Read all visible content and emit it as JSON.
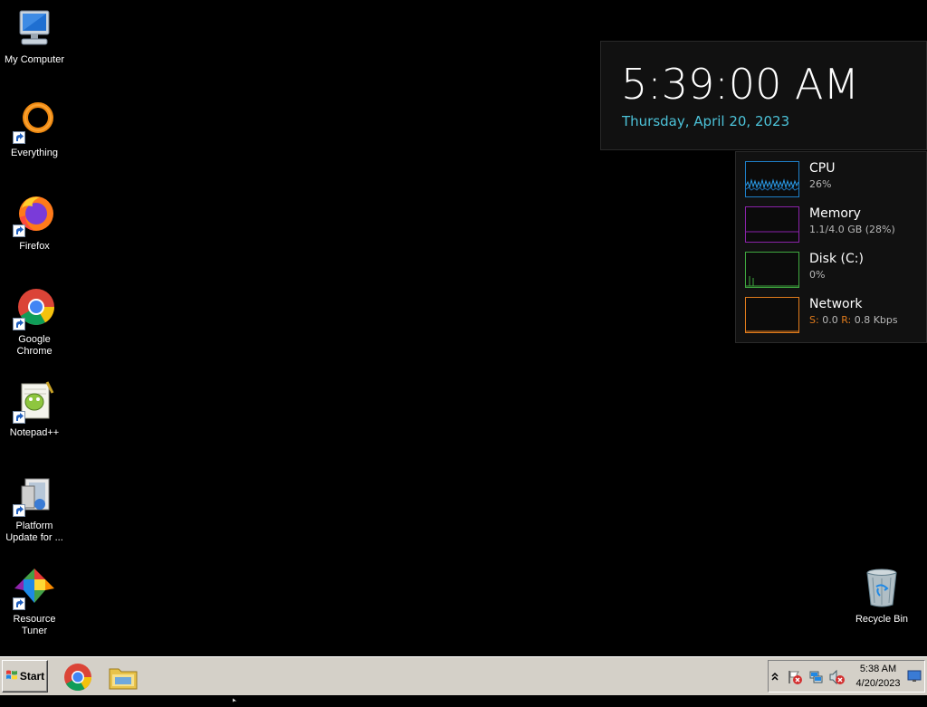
{
  "desktop": {
    "icons": [
      {
        "id": "my-computer",
        "label": "My Computer",
        "icon": "computer-icon"
      },
      {
        "id": "everything",
        "label": "Everything",
        "icon": "everything-icon"
      },
      {
        "id": "firefox",
        "label": "Firefox",
        "icon": "firefox-icon"
      },
      {
        "id": "google-chrome",
        "label": "Google Chrome",
        "icon": "chrome-icon"
      },
      {
        "id": "notepad-plus-plus",
        "label": "Notepad++",
        "icon": "notepad-plus-plus-icon"
      },
      {
        "id": "platform-update",
        "label": "Platform\nUpdate for ...",
        "icon": "installer-icon"
      },
      {
        "id": "resource-tuner",
        "label": "Resource\nTuner",
        "icon": "resource-tuner-icon"
      },
      {
        "id": "recycle-bin",
        "label": "Recycle Bin",
        "icon": "recycle-bin-icon"
      }
    ]
  },
  "clock_gadget": {
    "time": "5:39:00 AM",
    "date": "Thursday, April 20, 2023",
    "date_color": "#4cc2d8"
  },
  "perf_gadget": {
    "cpu": {
      "name": "CPU",
      "value": "26%",
      "color": "#1e7fc8"
    },
    "memory": {
      "name": "Memory",
      "value": "1.1/4.0 GB (28%)",
      "color": "#8a22a8"
    },
    "disk": {
      "name": "Disk (C:)",
      "value": "0%",
      "color": "#3fa83f"
    },
    "network": {
      "name": "Network",
      "s_label": "S:",
      "s_value": "0.0",
      "r_label": "R:",
      "r_value": "0.8 Kbps",
      "color": "#e07b1c"
    }
  },
  "taskbar": {
    "start_label": "Start",
    "pinned": [
      {
        "name": "chrome-taskbar-button",
        "icon": "chrome-icon"
      },
      {
        "name": "explorer-taskbar-button",
        "icon": "folder-icon"
      }
    ],
    "tray": {
      "time": "5:38 AM",
      "date": "4/20/2023"
    }
  }
}
